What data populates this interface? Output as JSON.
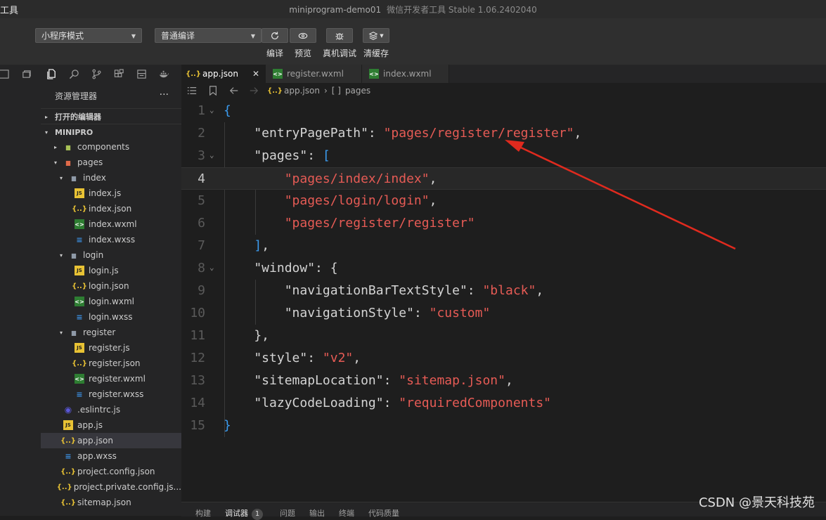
{
  "titlebar": {
    "app_title": "工具",
    "window_title": "miniprogram-demo01",
    "window_sub": "微信开发者工具 Stable 1.06.2402040"
  },
  "toolbar": {
    "mode_select": "小程序模式",
    "compile_select": "普通编译",
    "compile_label": "编译",
    "preview_label": "预览",
    "debug_label": "真机调试",
    "clear_cache_label": "清缓存"
  },
  "sidebar": {
    "title": "资源管理器",
    "more": "···",
    "open_editors": "打开的编辑器",
    "project": "MINIPRO",
    "tree": [
      {
        "label": "components",
        "icon": "folder-components",
        "arrow": "▸",
        "indent": 0
      },
      {
        "label": "pages",
        "icon": "folder-pages",
        "arrow": "▾",
        "indent": 0
      },
      {
        "label": "index",
        "icon": "folder",
        "arrow": "▾",
        "indent": 1
      },
      {
        "label": "index.js",
        "icon": "js",
        "arrow": "",
        "indent": 2
      },
      {
        "label": "index.json",
        "icon": "json",
        "arrow": "",
        "indent": 2
      },
      {
        "label": "index.wxml",
        "icon": "wxml",
        "arrow": "",
        "indent": 2
      },
      {
        "label": "index.wxss",
        "icon": "wxss",
        "arrow": "",
        "indent": 2
      },
      {
        "label": "login",
        "icon": "folder",
        "arrow": "▾",
        "indent": 1
      },
      {
        "label": "login.js",
        "icon": "js",
        "arrow": "",
        "indent": 2
      },
      {
        "label": "login.json",
        "icon": "json",
        "arrow": "",
        "indent": 2
      },
      {
        "label": "login.wxml",
        "icon": "wxml",
        "arrow": "",
        "indent": 2
      },
      {
        "label": "login.wxss",
        "icon": "wxss",
        "arrow": "",
        "indent": 2
      },
      {
        "label": "register",
        "icon": "folder",
        "arrow": "▾",
        "indent": 1
      },
      {
        "label": "register.js",
        "icon": "js",
        "arrow": "",
        "indent": 2
      },
      {
        "label": "register.json",
        "icon": "json",
        "arrow": "",
        "indent": 2
      },
      {
        "label": "register.wxml",
        "icon": "wxml",
        "arrow": "",
        "indent": 2
      },
      {
        "label": "register.wxss",
        "icon": "wxss",
        "arrow": "",
        "indent": 2
      },
      {
        "label": ".eslintrc.js",
        "icon": "eslint",
        "arrow": "",
        "indent": 0
      },
      {
        "label": "app.js",
        "icon": "js",
        "arrow": "",
        "indent": 0
      },
      {
        "label": "app.json",
        "icon": "json",
        "arrow": "",
        "indent": 0,
        "active": true
      },
      {
        "label": "app.wxss",
        "icon": "wxss",
        "arrow": "",
        "indent": 0
      },
      {
        "label": "project.config.json",
        "icon": "json",
        "arrow": "",
        "indent": 0
      },
      {
        "label": "project.private.config.js...",
        "icon": "json",
        "arrow": "",
        "indent": 0
      },
      {
        "label": "sitemap.json",
        "icon": "json",
        "arrow": "",
        "indent": 0
      }
    ]
  },
  "tabs": [
    {
      "label": "app.json",
      "icon": "json",
      "active": true,
      "close": "✕"
    },
    {
      "label": "register.wxml",
      "icon": "wxml",
      "active": false
    },
    {
      "label": "index.wxml",
      "icon": "wxml",
      "active": false
    }
  ],
  "breadcrumb": {
    "file": "app.json",
    "sep": "›",
    "node_icon": "[ ]",
    "node": "pages"
  },
  "code": {
    "current_line": 4,
    "lines": [
      {
        "n": "1",
        "fold": "⌄",
        "segs": [
          [
            "b",
            "{"
          ]
        ]
      },
      {
        "n": "2",
        "segs": [
          [
            "k",
            "    \"entryPagePath\""
          ],
          [
            "p",
            ": "
          ],
          [
            "s",
            "\"pages/register/register\""
          ],
          [
            "p",
            ","
          ]
        ]
      },
      {
        "n": "3",
        "fold": "⌄",
        "segs": [
          [
            "k",
            "    \"pages\""
          ],
          [
            "p",
            ": "
          ],
          [
            "b",
            "["
          ]
        ]
      },
      {
        "n": "4",
        "segs": [
          [
            "s",
            "        \"pages/index/index\""
          ],
          [
            "p",
            ","
          ]
        ]
      },
      {
        "n": "5",
        "segs": [
          [
            "s",
            "        \"pages/login/login\""
          ],
          [
            "p",
            ","
          ]
        ]
      },
      {
        "n": "6",
        "segs": [
          [
            "s",
            "        \"pages/register/register\""
          ]
        ]
      },
      {
        "n": "7",
        "segs": [
          [
            "b",
            "    ]"
          ],
          [
            "p",
            ","
          ]
        ]
      },
      {
        "n": "8",
        "fold": "⌄",
        "segs": [
          [
            "k",
            "    \"window\""
          ],
          [
            "p",
            ": {"
          ]
        ]
      },
      {
        "n": "9",
        "segs": [
          [
            "k",
            "        \"navigationBarTextStyle\""
          ],
          [
            "p",
            ": "
          ],
          [
            "s",
            "\"black\""
          ],
          [
            "p",
            ","
          ]
        ]
      },
      {
        "n": "10",
        "segs": [
          [
            "k",
            "        \"navigationStyle\""
          ],
          [
            "p",
            ": "
          ],
          [
            "s",
            "\"custom\""
          ]
        ]
      },
      {
        "n": "11",
        "segs": [
          [
            "p",
            "    },"
          ]
        ]
      },
      {
        "n": "12",
        "segs": [
          [
            "k",
            "    \"style\""
          ],
          [
            "p",
            ": "
          ],
          [
            "s",
            "\"v2\""
          ],
          [
            "p",
            ","
          ]
        ]
      },
      {
        "n": "13",
        "segs": [
          [
            "k",
            "    \"sitemapLocation\""
          ],
          [
            "p",
            ": "
          ],
          [
            "s",
            "\"sitemap.json\""
          ],
          [
            "p",
            ","
          ]
        ]
      },
      {
        "n": "14",
        "segs": [
          [
            "k",
            "    \"lazyCodeLoading\""
          ],
          [
            "p",
            ": "
          ],
          [
            "s",
            "\"requiredComponents\""
          ]
        ]
      },
      {
        "n": "15",
        "segs": [
          [
            "b",
            "}"
          ]
        ]
      }
    ]
  },
  "bottom_tabs": [
    {
      "label": "构建"
    },
    {
      "label": "调试器",
      "badge": "1",
      "active": true
    },
    {
      "label": "问题"
    },
    {
      "label": "输出"
    },
    {
      "label": "终端"
    },
    {
      "label": "代码质量"
    }
  ],
  "watermark": "CSDN @景天科技苑",
  "colors": {
    "string": "#e65b55",
    "key": "#d4d4d4",
    "bracket": "#3b9cf0",
    "arrow": "#e02a1e"
  }
}
